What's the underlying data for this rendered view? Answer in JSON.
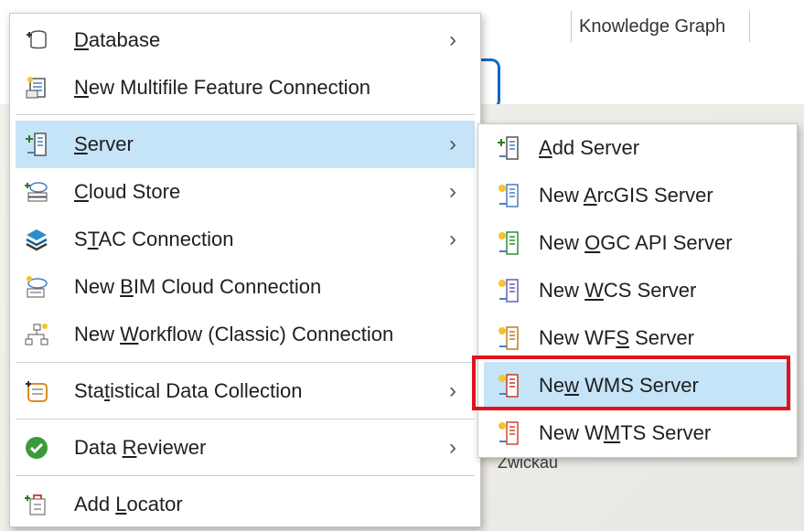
{
  "background": {
    "tab_label": "Knowledge Graph",
    "map_label": "Zwickau"
  },
  "main_menu": {
    "items": [
      {
        "pre": "",
        "ul": "D",
        "post": "atabase",
        "icon": "database-icon",
        "submenu": true
      },
      {
        "pre": "",
        "ul": "N",
        "post": "ew Multifile Feature Connection",
        "icon": "multifile-connection-icon",
        "submenu": false
      },
      {
        "pre": "",
        "ul": "S",
        "post": "erver",
        "icon": "server-icon",
        "submenu": true
      },
      {
        "pre": "",
        "ul": "C",
        "post": "loud Store",
        "icon": "cloud-store-icon",
        "submenu": true
      },
      {
        "pre": "S",
        "ul": "T",
        "post": "AC Connection",
        "icon": "stac-layers-icon",
        "submenu": true
      },
      {
        "pre": "New ",
        "ul": "B",
        "post": "IM Cloud Connection",
        "icon": "bim-cloud-icon",
        "submenu": false
      },
      {
        "pre": "New ",
        "ul": "W",
        "post": "orkflow (Classic) Connection",
        "icon": "workflow-icon",
        "submenu": false
      },
      {
        "pre": "Sta",
        "ul": "t",
        "post": "istical Data Collection",
        "icon": "statistical-data-icon",
        "submenu": true
      },
      {
        "pre": "Data ",
        "ul": "R",
        "post": "eviewer",
        "icon": "check-circle-icon",
        "submenu": true
      },
      {
        "pre": "Add ",
        "ul": "L",
        "post": "ocator",
        "icon": "locator-icon",
        "submenu": false
      }
    ]
  },
  "server_submenu": {
    "items": [
      {
        "pre": "",
        "ul": "A",
        "post": "dd Server",
        "icon": "add-server-icon"
      },
      {
        "pre": "New ",
        "ul": "A",
        "post": "rcGIS Server",
        "icon": "arcgis-server-icon"
      },
      {
        "pre": "New ",
        "ul": "O",
        "post": "GC API Server",
        "icon": "ogc-server-icon"
      },
      {
        "pre": "New ",
        "ul": "W",
        "post": "CS Server",
        "icon": "wcs-server-icon"
      },
      {
        "pre": "New WF",
        "ul": "S",
        "post": " Server",
        "icon": "wfs-server-icon"
      },
      {
        "pre": "Ne",
        "ul": "w",
        "post": " WMS Server",
        "icon": "wms-server-icon"
      },
      {
        "pre": "New W",
        "ul": "M",
        "post": "TS Server",
        "icon": "wmts-server-icon"
      }
    ]
  },
  "colors": {
    "hover": "#c6e4f8",
    "highlight_border": "#e0141b",
    "tab_accent": "#1565c0"
  }
}
